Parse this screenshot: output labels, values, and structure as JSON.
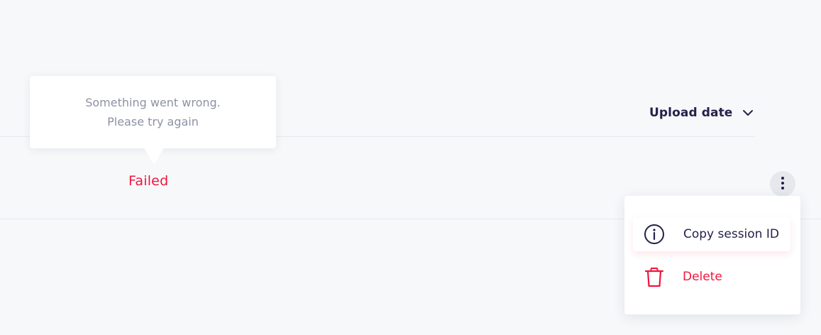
{
  "list_header": {
    "sort_label": "Upload date",
    "sort_icon": "chevron-down-icon"
  },
  "row": {
    "status": "Failed",
    "status_color": "#f0163e"
  },
  "tooltip": {
    "line1": "Something went wrong.",
    "line2": "Please try again"
  },
  "actions_menu": {
    "trigger_icon": "kebab-menu-icon",
    "items": [
      {
        "label": "Copy session ID",
        "icon": "info-circle-icon",
        "color": "#23224a"
      },
      {
        "label": "Delete",
        "icon": "trash-icon",
        "color": "#f0163e"
      }
    ]
  },
  "colors": {
    "background": "#f7f8fa",
    "text_dark": "#23224a",
    "text_muted": "#8d91a5",
    "danger": "#f0163e",
    "divider": "#e7e9ee"
  }
}
